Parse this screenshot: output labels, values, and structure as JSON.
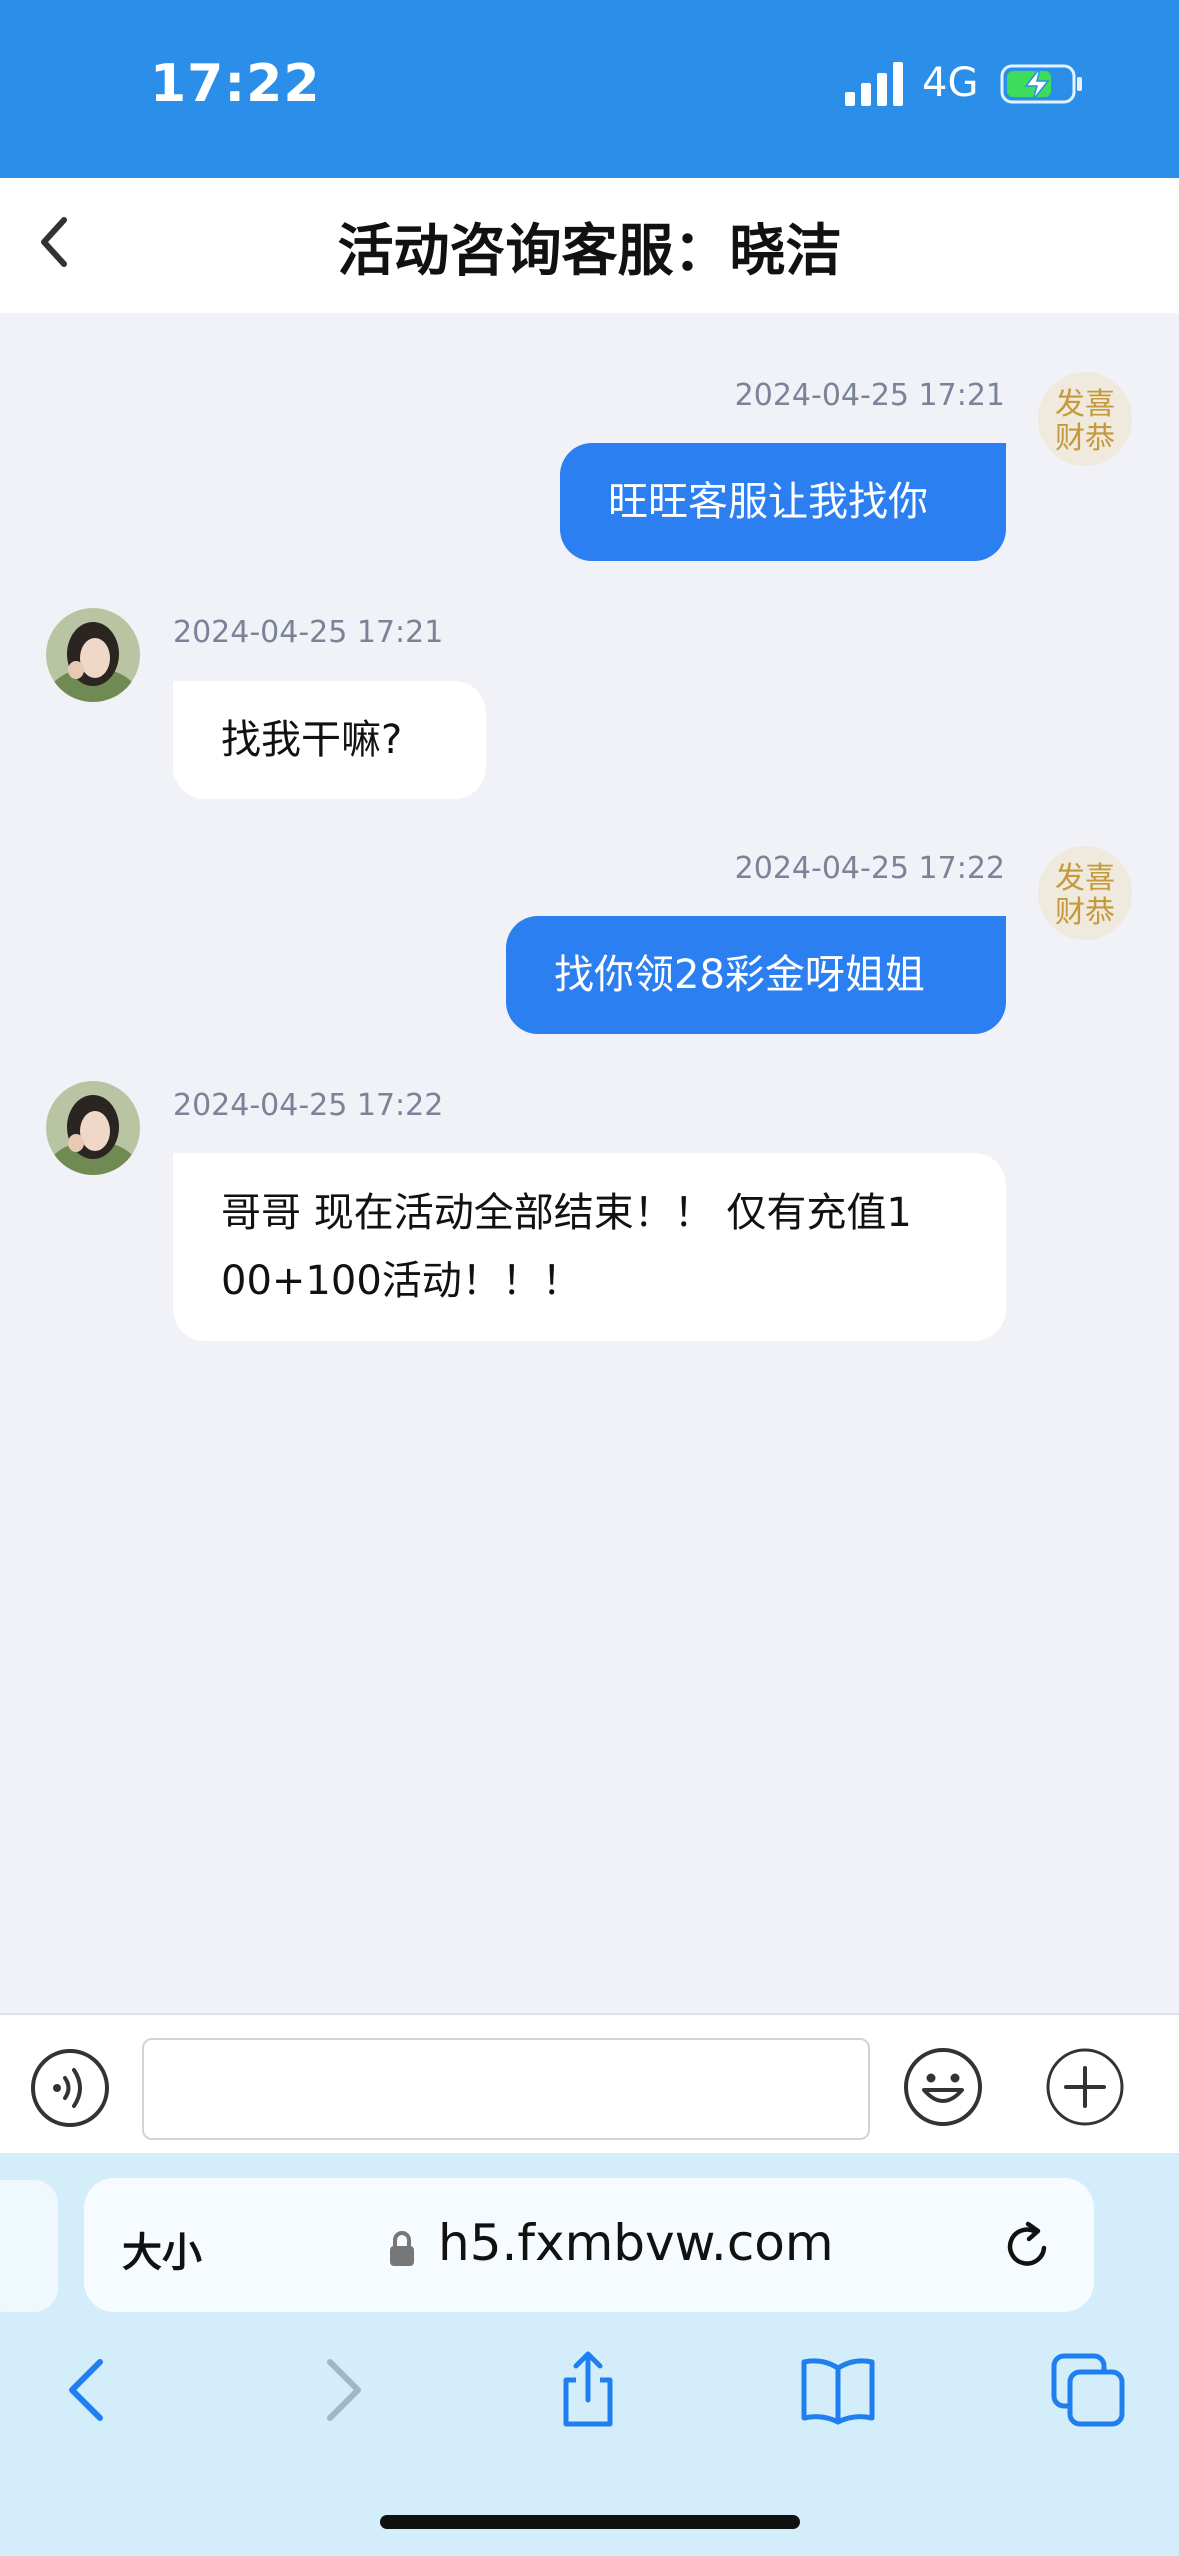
{
  "status_bar": {
    "time": "17:22",
    "network": "4G"
  },
  "header": {
    "title": "活动咨询客服：晓洁"
  },
  "messages": [
    {
      "direction": "out",
      "timestamp": "2024-04-25 17:21",
      "text": "旺旺客服让我找你"
    },
    {
      "direction": "in",
      "timestamp": "2024-04-25 17:21",
      "text": "找我干嘛?"
    },
    {
      "direction": "out",
      "timestamp": "2024-04-25 17:22",
      "text": "找你领28彩金呀姐姐"
    },
    {
      "direction": "in",
      "timestamp": "2024-04-25 17:22",
      "text": "哥哥 现在活动全部结束！！ 仅有充值1\n00+100活动！！！"
    }
  ],
  "self_avatar": {
    "line1": "发喜",
    "line2": "财恭"
  },
  "input": {
    "value": "",
    "placeholder": ""
  },
  "browser": {
    "text_size_label": "大小",
    "url": "h5.fxmbvw.com"
  },
  "icons": {
    "back": "chevron-left-icon",
    "voice": "voice-icon",
    "emoji": "smiley-icon",
    "plus": "plus-icon",
    "lock": "lock-icon",
    "reload": "reload-icon",
    "share": "share-icon",
    "bookmarks": "book-icon",
    "tabs": "tabs-icon"
  },
  "colors": {
    "status_bg": "#2b8fe9",
    "outgoing_bubble": "#2c7ff0",
    "chat_bg": "#f0f2f8",
    "browser_bg": "#d3edfb"
  }
}
